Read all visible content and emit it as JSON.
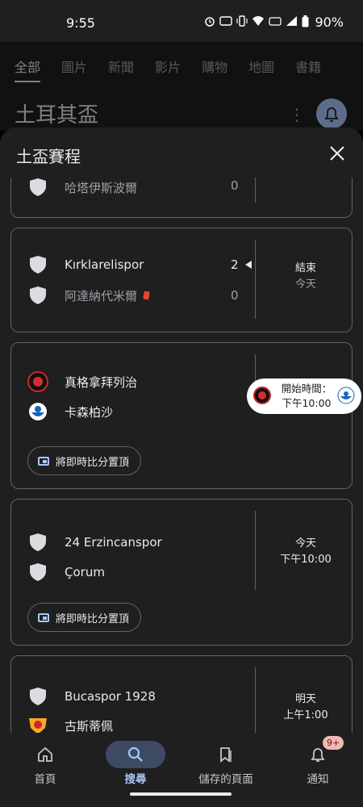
{
  "status_bar": {
    "time": "9:55",
    "battery": "90%"
  },
  "background": {
    "tabs": [
      "全部",
      "圖片",
      "新聞",
      "影片",
      "購物",
      "地圖",
      "書籍"
    ],
    "query_title": "土耳其盃"
  },
  "sheet": {
    "title": "土盃賽程",
    "matches": [
      {
        "home": "哈塔伊斯波爾",
        "home_score": "0"
      },
      {
        "home": "Kırklarelispor",
        "home_score": "2",
        "away": "阿達納代米爾",
        "away_score": "0",
        "status_line1": "結束",
        "status_line2": "今天"
      },
      {
        "home": "真格拿拜列治",
        "away": "卡森柏沙",
        "pin_label": "將即時比分置頂"
      },
      {
        "home": "24 Erzincanspor",
        "away": "Çorum",
        "status_line1": "今天",
        "status_line2": "下午10:00",
        "pin_label": "將即時比分置頂"
      },
      {
        "home": "Bucaspor 1928",
        "away": "古斯蒂佩",
        "status_line1": "明天",
        "status_line2": "上午1:00"
      }
    ],
    "tooltip": {
      "line1": "開始時間：",
      "line2": "下午10:00"
    }
  },
  "nav": {
    "items": [
      {
        "label": "首頁"
      },
      {
        "label": "搜尋"
      },
      {
        "label": "儲存的頁面"
      },
      {
        "label": "通知",
        "badge": "9+"
      }
    ]
  },
  "colors": {
    "accent": "#a8c7fa",
    "surface": "#1f1f1f",
    "divider": "#5f6368"
  }
}
